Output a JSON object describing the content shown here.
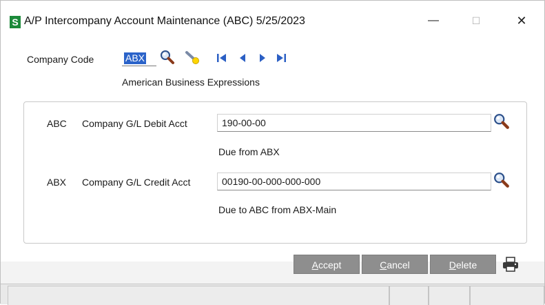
{
  "window": {
    "title": "A/P Intercompany Account Maintenance (ABC) 5/25/2023",
    "app_icon_letter": "S",
    "minimize_glyph": "—",
    "maximize_glyph": "☐",
    "close_glyph": "✕"
  },
  "company": {
    "label": "Company Code",
    "value": "ABX",
    "name": "American Business Expressions"
  },
  "debit": {
    "company": "ABC",
    "label": "Company G/L Debit Acct",
    "value": "190-00-00",
    "description": "Due from ABX"
  },
  "credit": {
    "company": "ABX",
    "label": "Company G/L Credit Acct",
    "value": "00190-00-000-000-000",
    "description": "Due to ABC from ABX-Main"
  },
  "buttons": {
    "accept": {
      "first": "A",
      "rest": "ccept"
    },
    "cancel": {
      "first": "C",
      "rest": "ancel"
    },
    "delete": {
      "first": "D",
      "rest": "elete"
    }
  },
  "icons": {
    "lookup": "magnifier-icon",
    "wizard": "flashlight-icon",
    "first": "first-record-icon",
    "prev": "previous-record-icon",
    "next": "next-record-icon",
    "last": "last-record-icon",
    "print": "printer-icon"
  },
  "colors": {
    "accent": "#2b63c9",
    "nav": "#2b5fc4",
    "button": "#8e8e8e",
    "app_icon": "#1c8a3a"
  }
}
